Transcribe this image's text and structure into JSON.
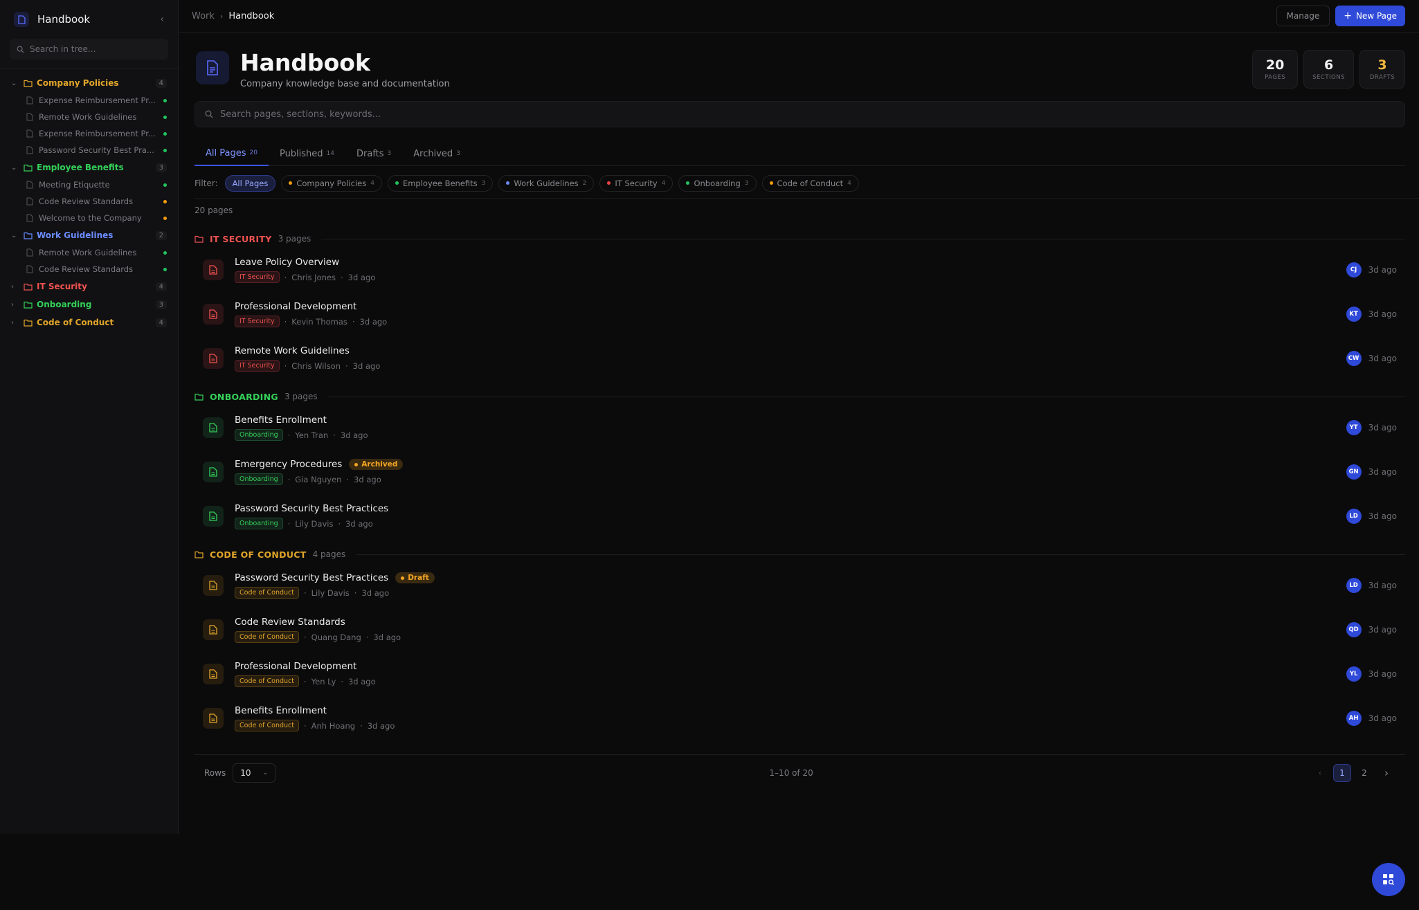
{
  "sidebar": {
    "title": "Handbook",
    "search_placeholder": "Search in tree...",
    "groups": [
      {
        "label": "Company Policies",
        "count": "4",
        "color": "#e0a52a",
        "expanded": true,
        "items": [
          {
            "label": "Expense Reimbursement Pr...",
            "status": "#22c55e"
          },
          {
            "label": "Remote Work Guidelines",
            "status": "#22c55e"
          },
          {
            "label": "Expense Reimbursement Pr...",
            "status": "#22c55e"
          },
          {
            "label": "Password Security Best Pra...",
            "status": "#22c55e"
          }
        ]
      },
      {
        "label": "Employee Benefits",
        "count": "3",
        "color": "#34d058",
        "expanded": true,
        "items": [
          {
            "label": "Meeting Etiquette",
            "status": "#22c55e"
          },
          {
            "label": "Code Review Standards",
            "status": "#f59e0b"
          },
          {
            "label": "Welcome to the Company",
            "status": "#f59e0b"
          }
        ]
      },
      {
        "label": "Work Guidelines",
        "count": "2",
        "color": "#6b8cff",
        "expanded": true,
        "items": [
          {
            "label": "Remote Work Guidelines",
            "status": "#22c55e"
          },
          {
            "label": "Code Review Standards",
            "status": "#22c55e"
          }
        ]
      },
      {
        "label": "IT Security",
        "count": "4",
        "color": "#f0524f",
        "expanded": false,
        "items": []
      },
      {
        "label": "Onboarding",
        "count": "3",
        "color": "#34d058",
        "expanded": false,
        "items": []
      },
      {
        "label": "Code of Conduct",
        "count": "4",
        "color": "#e0a52a",
        "expanded": false,
        "items": []
      }
    ]
  },
  "breadcrumb": {
    "parent": "Work",
    "current": "Handbook"
  },
  "header": {
    "manage_label": "Manage",
    "new_page_label": "New Page"
  },
  "hero": {
    "title": "Handbook",
    "subtitle": "Company knowledge base and documentation"
  },
  "stats": [
    {
      "value": "20",
      "label": "PAGES",
      "color": "#f2f2f2"
    },
    {
      "value": "6",
      "label": "SECTIONS",
      "color": "#f2f2f2"
    },
    {
      "value": "3",
      "label": "DRAFTS",
      "color": "#f5b83d"
    }
  ],
  "search": {
    "placeholder": "Search pages, sections, keywords..."
  },
  "tabs": [
    {
      "label": "All Pages",
      "count": "20",
      "active": true
    },
    {
      "label": "Published",
      "count": "14",
      "active": false
    },
    {
      "label": "Drafts",
      "count": "3",
      "active": false
    },
    {
      "label": "Archived",
      "count": "3",
      "active": false
    }
  ],
  "filters": {
    "label": "Filter:",
    "chips": [
      {
        "label": "All Pages",
        "count": "",
        "color": "",
        "active": true
      },
      {
        "label": "Company Policies",
        "count": "4",
        "color": "#f59e0b",
        "active": false
      },
      {
        "label": "Employee Benefits",
        "count": "3",
        "color": "#22c55e",
        "active": false
      },
      {
        "label": "Work Guidelines",
        "count": "2",
        "color": "#6b8cff",
        "active": false
      },
      {
        "label": "IT Security",
        "count": "4",
        "color": "#ef4444",
        "active": false
      },
      {
        "label": "Onboarding",
        "count": "3",
        "color": "#22c55e",
        "active": false
      },
      {
        "label": "Code of Conduct",
        "count": "4",
        "color": "#f59e0b",
        "active": false
      }
    ]
  },
  "page_count": "20 pages",
  "sections": [
    {
      "name": "IT SECURITY",
      "pages": "3 pages",
      "color": "#f0524f",
      "iconbg": "#2a1416",
      "tagbg": "#2a1416",
      "tagborder": "#5a2024",
      "rows": [
        {
          "title": "Leave Policy Overview",
          "tag": "IT Security",
          "author": "Chris Jones",
          "time": "3d ago",
          "initials": "CJ",
          "badge": "",
          "badge_color": ""
        },
        {
          "title": "Professional Development",
          "tag": "IT Security",
          "author": "Kevin Thomas",
          "time": "3d ago",
          "initials": "KT",
          "badge": "",
          "badge_color": ""
        },
        {
          "title": "Remote Work Guidelines",
          "tag": "IT Security",
          "author": "Chris Wilson",
          "time": "3d ago",
          "initials": "CW",
          "badge": "",
          "badge_color": ""
        }
      ]
    },
    {
      "name": "ONBOARDING",
      "pages": "3 pages",
      "color": "#34d058",
      "iconbg": "#12231a",
      "tagbg": "#12231a",
      "tagborder": "#1e4a2c",
      "rows": [
        {
          "title": "Benefits Enrollment",
          "tag": "Onboarding",
          "author": "Yen Tran",
          "time": "3d ago",
          "initials": "YT",
          "badge": "",
          "badge_color": ""
        },
        {
          "title": "Emergency Procedures",
          "tag": "Onboarding",
          "author": "Gia Nguyen",
          "time": "3d ago",
          "initials": "GN",
          "badge": "Archived",
          "badge_color": "#f5a623"
        },
        {
          "title": "Password Security Best Practices",
          "tag": "Onboarding",
          "author": "Lily Davis",
          "time": "3d ago",
          "initials": "LD",
          "badge": "",
          "badge_color": ""
        }
      ]
    },
    {
      "name": "CODE OF CONDUCT",
      "pages": "4 pages",
      "color": "#e0a52a",
      "iconbg": "#261d0f",
      "tagbg": "#261d0f",
      "tagborder": "#5a4114",
      "rows": [
        {
          "title": "Password Security Best Practices",
          "tag": "Code of Conduct",
          "author": "Lily Davis",
          "time": "3d ago",
          "initials": "LD",
          "badge": "Draft",
          "badge_color": "#f5a623"
        },
        {
          "title": "Code Review Standards",
          "tag": "Code of Conduct",
          "author": "Quang Dang",
          "time": "3d ago",
          "initials": "QD",
          "badge": "",
          "badge_color": ""
        },
        {
          "title": "Professional Development",
          "tag": "Code of Conduct",
          "author": "Yen Ly",
          "time": "3d ago",
          "initials": "YL",
          "badge": "",
          "badge_color": ""
        },
        {
          "title": "Benefits Enrollment",
          "tag": "Code of Conduct",
          "author": "Anh Hoang",
          "time": "3d ago",
          "initials": "AH",
          "badge": "",
          "badge_color": ""
        }
      ]
    }
  ],
  "pagination": {
    "rows_label": "Rows",
    "rows_value": "10",
    "range": "1–10 of 20",
    "pages": [
      "1",
      "2"
    ],
    "current": "1"
  },
  "icons": {
    "fab": "grid-search-icon",
    "page": "document-icon",
    "folder": "folder-icon"
  }
}
